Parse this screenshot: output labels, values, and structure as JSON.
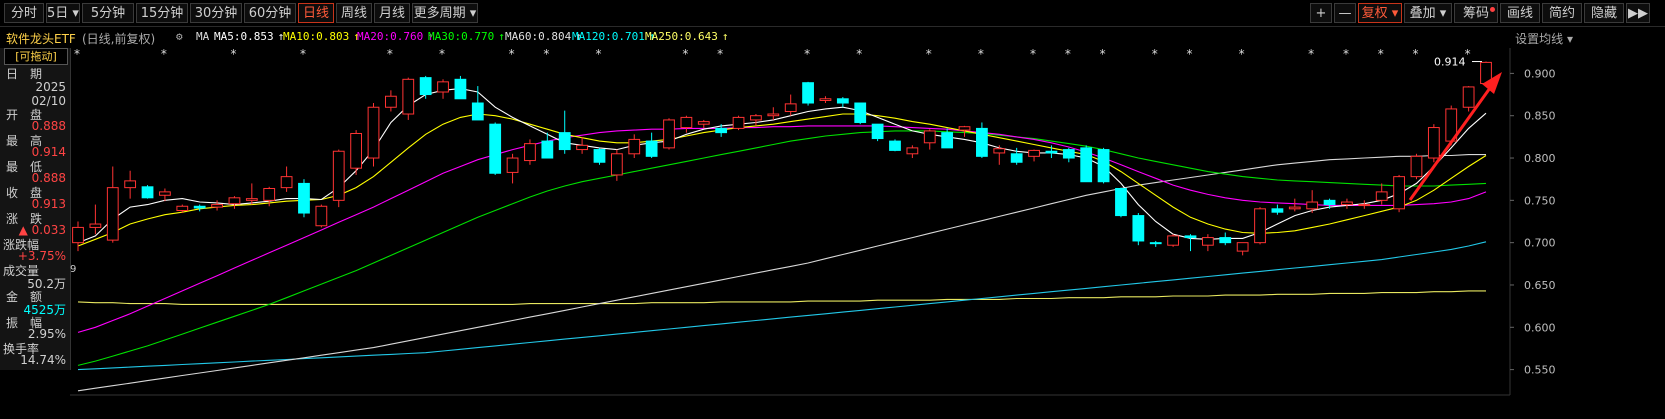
{
  "toolbar": {
    "periods": [
      "分时",
      "5日",
      "5分钟",
      "15分钟",
      "30分钟",
      "60分钟",
      "日线",
      "周线",
      "月线",
      "更多周期"
    ],
    "active": "日线",
    "right_buttons": [
      "+",
      "—",
      "复权",
      "叠加",
      "筹码",
      "画线",
      "简约",
      "隐藏",
      "▶▶"
    ]
  },
  "header": {
    "name": "软件龙头ETF",
    "mode": "(日线,前复权)",
    "ma_label": "MA",
    "ma_items": [
      {
        "text": "MA5:0.853",
        "arrow": "↑",
        "color": "#ffffff"
      },
      {
        "text": "MA10:0.803",
        "arrow": "↑",
        "color": "#ffff00"
      },
      {
        "text": "MA20:0.760",
        "arrow": "↑",
        "color": "#ff00ff"
      },
      {
        "text": "MA30:0.770",
        "arrow": "↑",
        "color": "#00ff00"
      },
      {
        "text": "MA60:0.804",
        "arrow": "↑",
        "color": "#e0e0e0"
      },
      {
        "text": "MA120:0.701",
        "arrow": "↑",
        "color": "#00ffff"
      },
      {
        "text": "MA250:0.643",
        "arrow": "↑",
        "color": "#ffff66"
      }
    ],
    "settings": "设置均线"
  },
  "panel": {
    "drag": "[可拖动]",
    "date_label": "日　期",
    "date_year": "2025",
    "date_md": "02/10",
    "open_label": "开　盘",
    "open": "0.888",
    "high_label": "最　高",
    "high": "0.914",
    "low_label": "最　低",
    "low": "0.888",
    "close_label": "收　盘",
    "close": "0.913",
    "chg_label": "涨　跌",
    "chg": "▲ 0.033",
    "pct_label": "涨跌幅",
    "pct": "+3.75%",
    "vol_label": "成交量",
    "vol": "50.2万",
    "amt_label": "金　额",
    "amt": "4525万",
    "amp_label": "振　幅",
    "amp": "2.95%",
    "turn_label": "换手率",
    "turn": "14.74%"
  },
  "colors": {
    "up": "#ff3333",
    "down": "#00ffff",
    "bg": "#000000"
  },
  "chart_data": {
    "type": "candlestick",
    "ylim": [
      0.52,
      0.93
    ],
    "yticks": [
      0.55,
      0.6,
      0.65,
      0.7,
      0.75,
      0.8,
      0.85,
      0.9
    ],
    "max_label": "0.914",
    "ohlc": [
      [
        0.7,
        0.725,
        0.69,
        0.718
      ],
      [
        0.718,
        0.745,
        0.71,
        0.722
      ],
      [
        0.703,
        0.79,
        0.7,
        0.765
      ],
      [
        0.765,
        0.785,
        0.752,
        0.773
      ],
      [
        0.766,
        0.768,
        0.752,
        0.753
      ],
      [
        0.756,
        0.764,
        0.749,
        0.76
      ],
      [
        0.738,
        0.745,
        0.735,
        0.743
      ],
      [
        0.743,
        0.745,
        0.737,
        0.741
      ],
      [
        0.742,
        0.75,
        0.738,
        0.745
      ],
      [
        0.746,
        0.755,
        0.74,
        0.753
      ],
      [
        0.75,
        0.77,
        0.745,
        0.752
      ],
      [
        0.75,
        0.766,
        0.743,
        0.764
      ],
      [
        0.765,
        0.79,
        0.76,
        0.778
      ],
      [
        0.77,
        0.775,
        0.73,
        0.735
      ],
      [
        0.72,
        0.745,
        0.718,
        0.743
      ],
      [
        0.75,
        0.81,
        0.742,
        0.808
      ],
      [
        0.788,
        0.833,
        0.78,
        0.829
      ],
      [
        0.8,
        0.865,
        0.79,
        0.86
      ],
      [
        0.86,
        0.88,
        0.855,
        0.873
      ],
      [
        0.852,
        0.895,
        0.845,
        0.893
      ],
      [
        0.895,
        0.897,
        0.87,
        0.875
      ],
      [
        0.878,
        0.893,
        0.87,
        0.89
      ],
      [
        0.893,
        0.897,
        0.87,
        0.87
      ],
      [
        0.865,
        0.885,
        0.845,
        0.845
      ],
      [
        0.84,
        0.842,
        0.78,
        0.782
      ],
      [
        0.783,
        0.805,
        0.77,
        0.8
      ],
      [
        0.797,
        0.822,
        0.792,
        0.817
      ],
      [
        0.82,
        0.83,
        0.8,
        0.8
      ],
      [
        0.83,
        0.856,
        0.805,
        0.81
      ],
      [
        0.81,
        0.825,
        0.805,
        0.815
      ],
      [
        0.81,
        0.812,
        0.792,
        0.795
      ],
      [
        0.78,
        0.81,
        0.773,
        0.805
      ],
      [
        0.805,
        0.828,
        0.8,
        0.822
      ],
      [
        0.82,
        0.83,
        0.8,
        0.802
      ],
      [
        0.812,
        0.847,
        0.81,
        0.845
      ],
      [
        0.836,
        0.85,
        0.83,
        0.848
      ],
      [
        0.84,
        0.845,
        0.835,
        0.843
      ],
      [
        0.835,
        0.84,
        0.825,
        0.83
      ],
      [
        0.835,
        0.85,
        0.833,
        0.848
      ],
      [
        0.845,
        0.852,
        0.838,
        0.85
      ],
      [
        0.85,
        0.86,
        0.845,
        0.852
      ],
      [
        0.855,
        0.875,
        0.85,
        0.864
      ],
      [
        0.889,
        0.89,
        0.862,
        0.865
      ],
      [
        0.868,
        0.873,
        0.865,
        0.87
      ],
      [
        0.87,
        0.872,
        0.86,
        0.865
      ],
      [
        0.865,
        0.865,
        0.84,
        0.842
      ],
      [
        0.84,
        0.838,
        0.82,
        0.823
      ],
      [
        0.82,
        0.822,
        0.808,
        0.809
      ],
      [
        0.805,
        0.815,
        0.8,
        0.812
      ],
      [
        0.818,
        0.834,
        0.81,
        0.832
      ],
      [
        0.83,
        0.835,
        0.812,
        0.812
      ],
      [
        0.833,
        0.838,
        0.825,
        0.837
      ],
      [
        0.835,
        0.842,
        0.8,
        0.802
      ],
      [
        0.806,
        0.815,
        0.792,
        0.811
      ],
      [
        0.805,
        0.812,
        0.792,
        0.795
      ],
      [
        0.802,
        0.81,
        0.796,
        0.809
      ],
      [
        0.808,
        0.815,
        0.8,
        0.806
      ],
      [
        0.81,
        0.812,
        0.795,
        0.8
      ],
      [
        0.812,
        0.815,
        0.795,
        0.772
      ],
      [
        0.81,
        0.812,
        0.77,
        0.772
      ],
      [
        0.764,
        0.765,
        0.73,
        0.732
      ],
      [
        0.732,
        0.735,
        0.697,
        0.702
      ],
      [
        0.7,
        0.702,
        0.695,
        0.699
      ],
      [
        0.697,
        0.71,
        0.695,
        0.708
      ],
      [
        0.708,
        0.71,
        0.69,
        0.706
      ],
      [
        0.697,
        0.71,
        0.69,
        0.706
      ],
      [
        0.706,
        0.712,
        0.697,
        0.7
      ],
      [
        0.69,
        0.7,
        0.685,
        0.7
      ],
      [
        0.7,
        0.742,
        0.698,
        0.74
      ],
      [
        0.74,
        0.745,
        0.733,
        0.736
      ],
      [
        0.74,
        0.752,
        0.737,
        0.742
      ],
      [
        0.74,
        0.762,
        0.735,
        0.748
      ],
      [
        0.75,
        0.752,
        0.74,
        0.745
      ],
      [
        0.745,
        0.752,
        0.74,
        0.748
      ],
      [
        0.745,
        0.75,
        0.74,
        0.745
      ],
      [
        0.75,
        0.77,
        0.745,
        0.76
      ],
      [
        0.74,
        0.78,
        0.736,
        0.778
      ],
      [
        0.778,
        0.805,
        0.775,
        0.802
      ],
      [
        0.8,
        0.84,
        0.795,
        0.836
      ],
      [
        0.82,
        0.862,
        0.815,
        0.858
      ],
      [
        0.86,
        0.885,
        0.855,
        0.884
      ],
      [
        0.888,
        0.914,
        0.888,
        0.913
      ]
    ],
    "ma5": [
      0.7,
      0.708,
      0.728,
      0.742,
      0.745,
      0.75,
      0.752,
      0.748,
      0.747,
      0.745,
      0.747,
      0.749,
      0.752,
      0.752,
      0.751,
      0.765,
      0.785,
      0.81,
      0.842,
      0.862,
      0.875,
      0.88,
      0.882,
      0.878,
      0.86,
      0.848,
      0.838,
      0.828,
      0.818,
      0.815,
      0.812,
      0.81,
      0.815,
      0.818,
      0.82,
      0.828,
      0.834,
      0.838,
      0.84,
      0.842,
      0.845,
      0.85,
      0.855,
      0.858,
      0.86,
      0.856,
      0.848,
      0.84,
      0.832,
      0.828,
      0.825,
      0.822,
      0.818,
      0.812,
      0.808,
      0.806,
      0.806,
      0.804,
      0.8,
      0.79,
      0.77,
      0.745,
      0.725,
      0.71,
      0.705,
      0.704,
      0.705,
      0.705,
      0.712,
      0.722,
      0.732,
      0.738,
      0.742,
      0.744,
      0.746,
      0.75,
      0.758,
      0.77,
      0.79,
      0.812,
      0.835,
      0.853
    ],
    "ma10": [
      0.696,
      0.704,
      0.712,
      0.722,
      0.728,
      0.733,
      0.736,
      0.74,
      0.742,
      0.744,
      0.745,
      0.747,
      0.749,
      0.75,
      0.751,
      0.756,
      0.765,
      0.778,
      0.795,
      0.812,
      0.828,
      0.84,
      0.848,
      0.852,
      0.85,
      0.846,
      0.84,
      0.834,
      0.828,
      0.824,
      0.82,
      0.818,
      0.818,
      0.82,
      0.822,
      0.826,
      0.83,
      0.833,
      0.836,
      0.838,
      0.84,
      0.843,
      0.846,
      0.849,
      0.852,
      0.852,
      0.85,
      0.847,
      0.843,
      0.84,
      0.836,
      0.832,
      0.828,
      0.824,
      0.82,
      0.816,
      0.812,
      0.808,
      0.804,
      0.796,
      0.784,
      0.77,
      0.756,
      0.742,
      0.73,
      0.722,
      0.716,
      0.712,
      0.711,
      0.712,
      0.714,
      0.718,
      0.722,
      0.727,
      0.732,
      0.737,
      0.742,
      0.75,
      0.762,
      0.776,
      0.79,
      0.803
    ],
    "ma20": [
      0.594,
      0.6,
      0.608,
      0.616,
      0.625,
      0.634,
      0.643,
      0.652,
      0.661,
      0.67,
      0.679,
      0.688,
      0.697,
      0.706,
      0.715,
      0.724,
      0.733,
      0.742,
      0.752,
      0.762,
      0.772,
      0.782,
      0.79,
      0.798,
      0.804,
      0.81,
      0.815,
      0.82,
      0.824,
      0.827,
      0.83,
      0.832,
      0.833,
      0.834,
      0.834,
      0.835,
      0.835,
      0.835,
      0.836,
      0.836,
      0.837,
      0.837,
      0.838,
      0.838,
      0.838,
      0.838,
      0.838,
      0.837,
      0.836,
      0.835,
      0.834,
      0.832,
      0.83,
      0.828,
      0.825,
      0.822,
      0.818,
      0.813,
      0.807,
      0.8,
      0.792,
      0.784,
      0.776,
      0.768,
      0.762,
      0.757,
      0.753,
      0.75,
      0.748,
      0.747,
      0.746,
      0.745,
      0.744,
      0.744,
      0.744,
      0.744,
      0.744,
      0.745,
      0.746,
      0.748,
      0.752,
      0.76
    ],
    "ma30": [
      0.555,
      0.56,
      0.566,
      0.572,
      0.578,
      0.585,
      0.592,
      0.599,
      0.606,
      0.613,
      0.62,
      0.627,
      0.635,
      0.643,
      0.651,
      0.659,
      0.667,
      0.676,
      0.685,
      0.694,
      0.703,
      0.712,
      0.721,
      0.73,
      0.738,
      0.746,
      0.754,
      0.761,
      0.767,
      0.772,
      0.776,
      0.78,
      0.784,
      0.788,
      0.792,
      0.796,
      0.8,
      0.804,
      0.808,
      0.812,
      0.816,
      0.82,
      0.823,
      0.826,
      0.828,
      0.83,
      0.831,
      0.832,
      0.832,
      0.832,
      0.831,
      0.83,
      0.829,
      0.827,
      0.825,
      0.823,
      0.82,
      0.817,
      0.814,
      0.81,
      0.805,
      0.8,
      0.796,
      0.792,
      0.788,
      0.784,
      0.781,
      0.778,
      0.776,
      0.774,
      0.773,
      0.772,
      0.771,
      0.77,
      0.769,
      0.768,
      0.767,
      0.767,
      0.767,
      0.768,
      0.769,
      0.77
    ],
    "ma60": [
      0.525,
      0.528,
      0.531,
      0.534,
      0.537,
      0.54,
      0.543,
      0.546,
      0.549,
      0.552,
      0.555,
      0.558,
      0.561,
      0.564,
      0.567,
      0.57,
      0.573,
      0.576,
      0.58,
      0.584,
      0.588,
      0.592,
      0.596,
      0.6,
      0.604,
      0.608,
      0.612,
      0.616,
      0.62,
      0.624,
      0.628,
      0.632,
      0.636,
      0.64,
      0.644,
      0.648,
      0.652,
      0.656,
      0.66,
      0.664,
      0.668,
      0.672,
      0.676,
      0.681,
      0.686,
      0.691,
      0.696,
      0.701,
      0.706,
      0.711,
      0.716,
      0.721,
      0.726,
      0.731,
      0.736,
      0.741,
      0.746,
      0.751,
      0.756,
      0.76,
      0.764,
      0.768,
      0.771,
      0.774,
      0.777,
      0.78,
      0.783,
      0.786,
      0.789,
      0.792,
      0.794,
      0.796,
      0.798,
      0.799,
      0.8,
      0.801,
      0.802,
      0.802,
      0.803,
      0.803,
      0.804,
      0.804
    ],
    "ma120": [
      0.55,
      0.551,
      0.552,
      0.553,
      0.554,
      0.555,
      0.556,
      0.557,
      0.558,
      0.559,
      0.56,
      0.561,
      0.562,
      0.563,
      0.564,
      0.565,
      0.566,
      0.567,
      0.568,
      0.569,
      0.57,
      0.572,
      0.574,
      0.576,
      0.578,
      0.58,
      0.582,
      0.584,
      0.586,
      0.588,
      0.59,
      0.592,
      0.594,
      0.596,
      0.598,
      0.6,
      0.602,
      0.604,
      0.606,
      0.608,
      0.61,
      0.612,
      0.614,
      0.616,
      0.618,
      0.62,
      0.622,
      0.624,
      0.626,
      0.628,
      0.63,
      0.632,
      0.634,
      0.636,
      0.638,
      0.64,
      0.642,
      0.644,
      0.646,
      0.648,
      0.65,
      0.652,
      0.654,
      0.656,
      0.658,
      0.66,
      0.662,
      0.664,
      0.666,
      0.668,
      0.67,
      0.672,
      0.674,
      0.676,
      0.678,
      0.68,
      0.683,
      0.686,
      0.689,
      0.692,
      0.696,
      0.701
    ],
    "ma250": [
      0.63,
      0.629,
      0.629,
      0.628,
      0.628,
      0.628,
      0.627,
      0.627,
      0.627,
      0.627,
      0.627,
      0.627,
      0.627,
      0.627,
      0.627,
      0.627,
      0.627,
      0.627,
      0.627,
      0.627,
      0.627,
      0.627,
      0.627,
      0.627,
      0.627,
      0.627,
      0.628,
      0.628,
      0.628,
      0.628,
      0.628,
      0.628,
      0.628,
      0.629,
      0.629,
      0.629,
      0.629,
      0.63,
      0.63,
      0.63,
      0.63,
      0.63,
      0.631,
      0.631,
      0.631,
      0.631,
      0.632,
      0.632,
      0.632,
      0.632,
      0.633,
      0.633,
      0.633,
      0.633,
      0.634,
      0.634,
      0.634,
      0.635,
      0.635,
      0.635,
      0.636,
      0.636,
      0.636,
      0.637,
      0.637,
      0.637,
      0.638,
      0.638,
      0.638,
      0.639,
      0.639,
      0.639,
      0.64,
      0.64,
      0.64,
      0.641,
      0.641,
      0.641,
      0.642,
      0.642,
      0.643,
      0.643
    ],
    "marker_indices": [
      0,
      5,
      9,
      13,
      18,
      21,
      25,
      27,
      30,
      35,
      37,
      42,
      45,
      49,
      52,
      55,
      57,
      59,
      62,
      64,
      67,
      71,
      73,
      75,
      77,
      80
    ]
  }
}
